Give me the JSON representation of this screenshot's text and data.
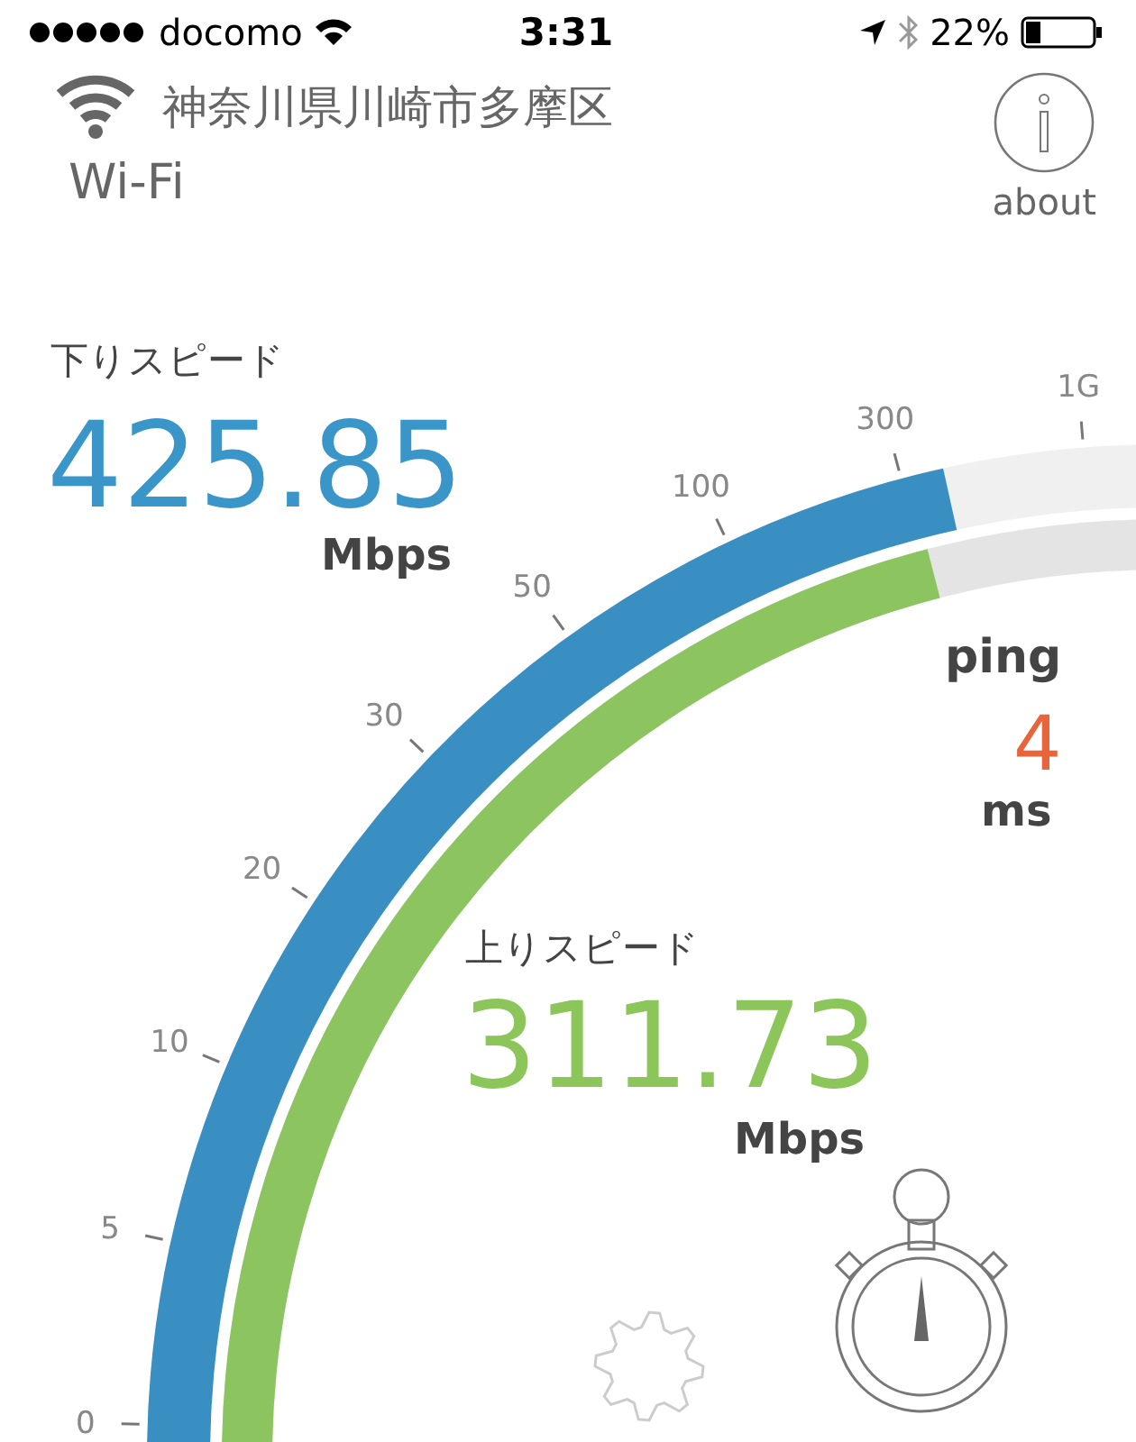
{
  "status_bar": {
    "carrier": "docomo",
    "time": "3:31",
    "battery": "22%"
  },
  "header": {
    "location": "神奈川県川崎市多摩区",
    "network": "Wi-Fi",
    "about": "about"
  },
  "gauge": {
    "ticks": [
      "0",
      "5",
      "10",
      "20",
      "30",
      "50",
      "100",
      "300",
      "1G"
    ],
    "download": {
      "label": "下りスピード",
      "value": "425.85",
      "unit": "Mbps"
    },
    "upload": {
      "label": "上りスピード",
      "value": "311.73",
      "unit": "Mbps"
    },
    "ping": {
      "label": "ping",
      "value": "4",
      "unit": "ms"
    }
  }
}
